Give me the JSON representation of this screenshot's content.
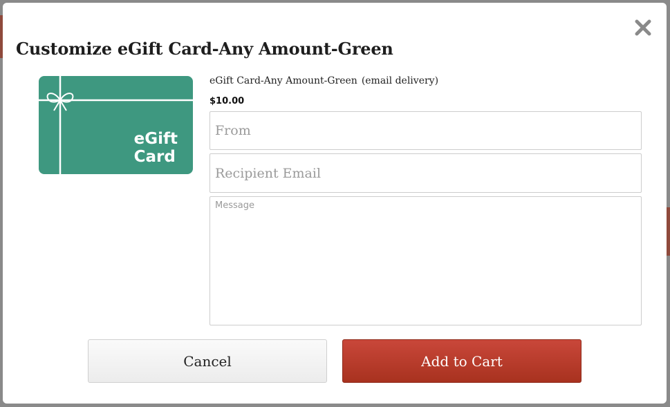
{
  "modal": {
    "title": "Customize eGift Card-Any Amount-Green",
    "close_icon": "close-icon"
  },
  "product": {
    "name": "eGift Card-Any Amount-Green",
    "delivery": "(email delivery)",
    "price": "$10.00",
    "card_image_text_line1": "eGift",
    "card_image_text_line2": "Card",
    "card_color": "#3e9880"
  },
  "form": {
    "from_placeholder": "From",
    "recipient_placeholder": "Recipient Email",
    "message_placeholder": "Message"
  },
  "buttons": {
    "cancel_label": "Cancel",
    "add_label": "Add to Cart",
    "add_color": "#b83c2b"
  }
}
